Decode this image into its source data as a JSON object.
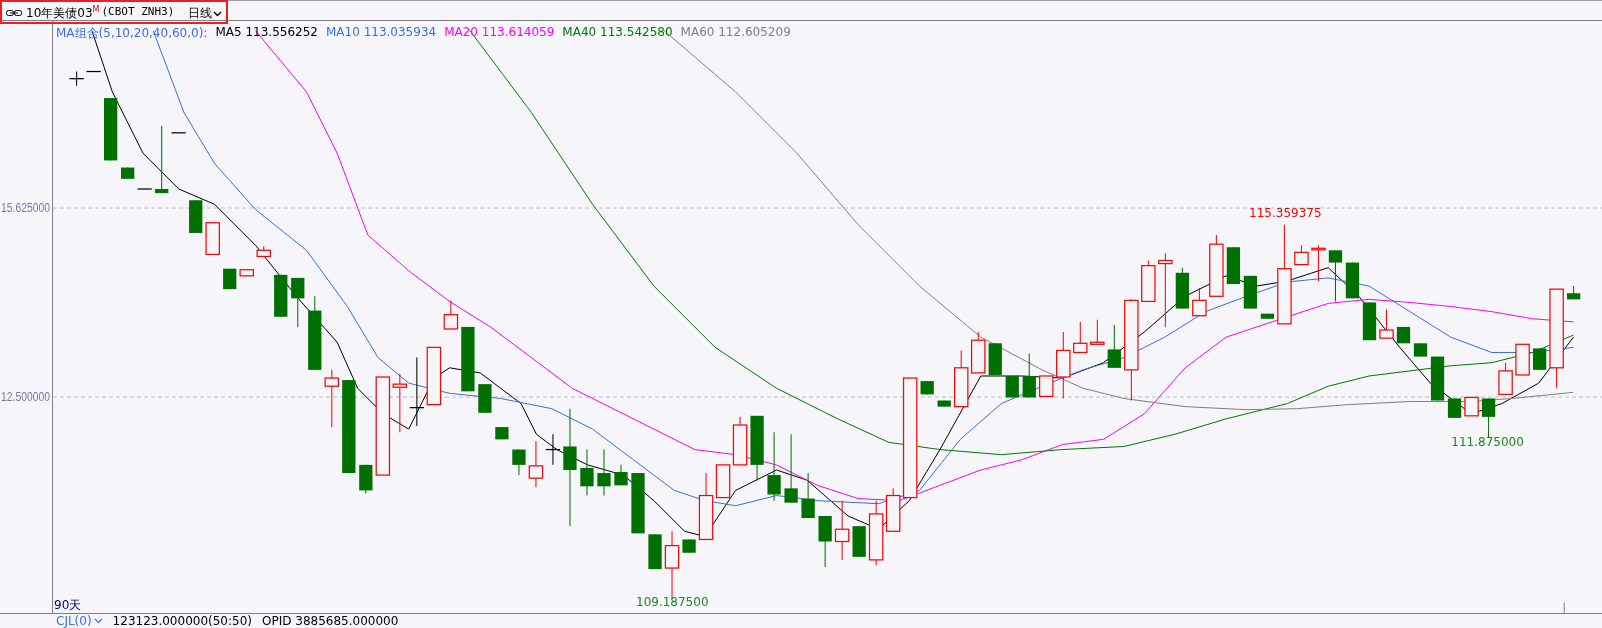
{
  "header": {
    "instrument": "10年美债03",
    "badge": "M",
    "code": "(CBOT ZNH3)",
    "period": "日线"
  },
  "legend": {
    "label": "MA组合(5,10,20,40,60,0):",
    "averages": [
      {
        "name": "MA5",
        "value": "113.556252",
        "color": "#000000"
      },
      {
        "name": "MA10",
        "value": "113.035934",
        "color": "#3a6fe0"
      },
      {
        "name": "MA20",
        "value": "113.614059",
        "color": "#ff00ff"
      },
      {
        "name": "MA40",
        "value": "113.542580",
        "color": "#007a00"
      },
      {
        "name": "MA60",
        "value": "112.605209",
        "color": "#808080"
      }
    ]
  },
  "y_axis": {
    "labels": [
      "15.625000",
      "12.500000"
    ]
  },
  "chart": {
    "range_label": "90天",
    "annotations": [
      {
        "kind": "high",
        "text": "115.359375"
      },
      {
        "kind": "low",
        "text": "111.875000"
      },
      {
        "kind": "low",
        "text": "109.187500"
      }
    ]
  },
  "footer": {
    "indicator": "CJL(0)",
    "volume": "123123.000000(50:50)",
    "opid": "OPID 3885685.000000"
  }
}
